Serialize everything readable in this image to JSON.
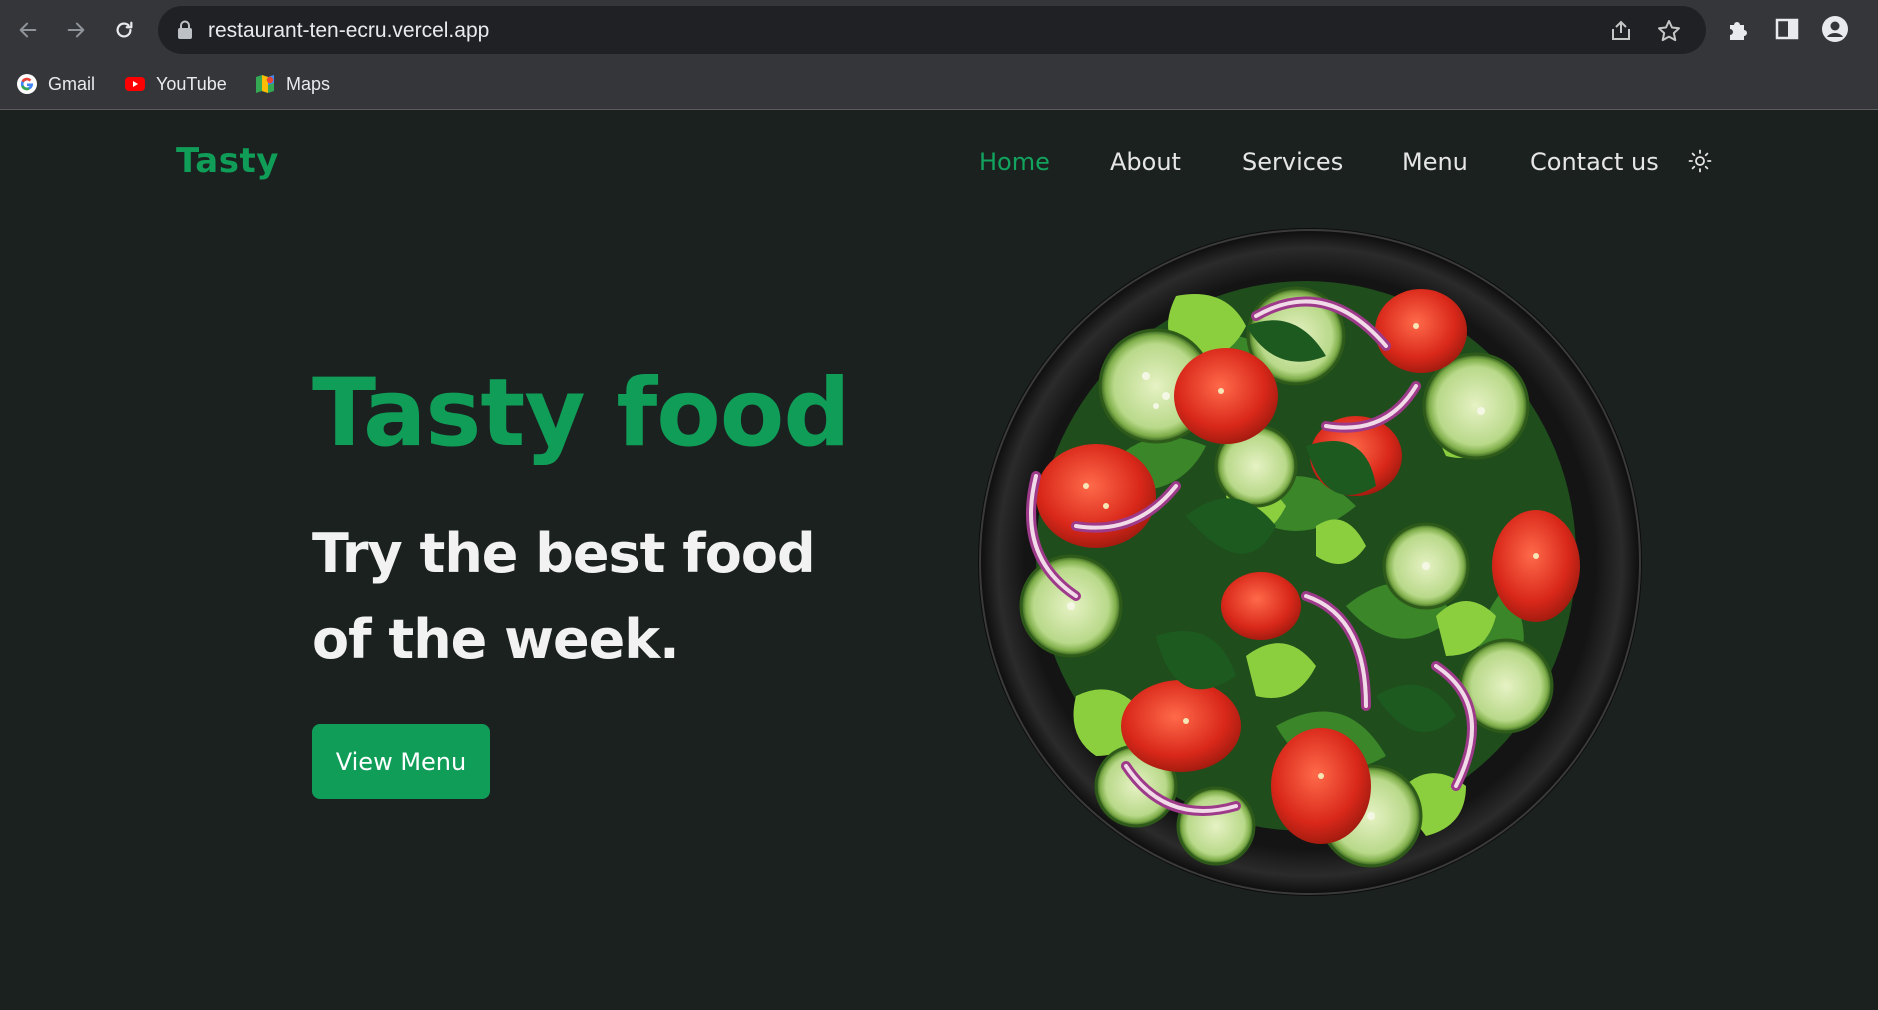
{
  "browser": {
    "url": "restaurant-ten-ecru.vercel.app",
    "bookmarks": [
      {
        "label": "Gmail",
        "icon": "google-icon"
      },
      {
        "label": "YouTube",
        "icon": "youtube-icon"
      },
      {
        "label": "Maps",
        "icon": "maps-icon"
      }
    ]
  },
  "site": {
    "logo": "Tasty",
    "nav": [
      "Home",
      "About",
      "Services",
      "Menu",
      "Contact us"
    ],
    "active_nav": "Home",
    "theme_icon": "sun-icon",
    "hero": {
      "title": "Tasty food",
      "subtitle": "Try the best food of the week.",
      "cta": "View Menu",
      "image": "salad-bowl"
    }
  },
  "colors": {
    "accent": "#0f9d58",
    "page_bg": "#1b211f",
    "chrome_bg": "#35363a",
    "omnibox_bg": "#202124"
  }
}
